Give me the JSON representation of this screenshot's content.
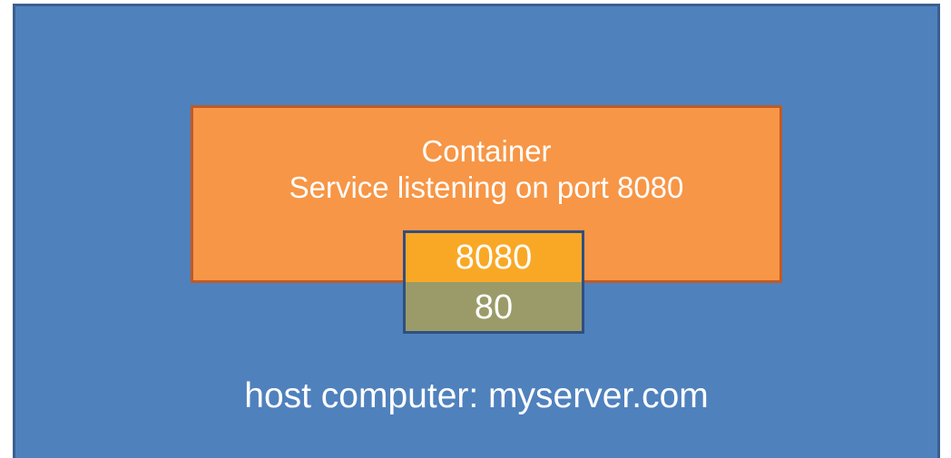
{
  "colors": {
    "host_fill": "#4f81bd",
    "container_fill": "#f79646",
    "container_port_fill": "#f9a826",
    "host_port_fill": "#9b9b6a",
    "text": "#ffffff"
  },
  "diagram": {
    "container": {
      "title": "Container",
      "description": "Service listening on port 8080"
    },
    "ports": {
      "container_port": "8080",
      "host_port": "80"
    },
    "host": {
      "label": "host computer: myserver.com"
    }
  }
}
